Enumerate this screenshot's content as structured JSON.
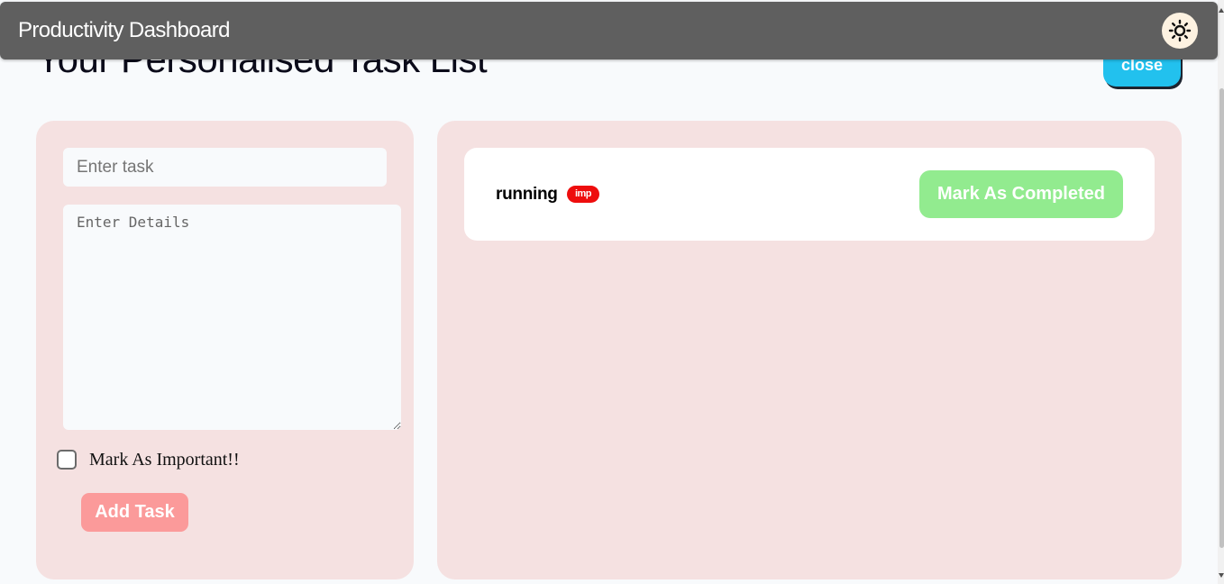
{
  "header": {
    "app_title": "Productivity Dashboard",
    "theme_toggle_icon": "sun-icon"
  },
  "main": {
    "page_title": "Your Personalised Task List",
    "close_label": "close",
    "accent_color": "#22c1ee"
  },
  "form": {
    "task_placeholder": "Enter task",
    "task_value": "",
    "details_placeholder": "Enter Details",
    "details_value": "",
    "important_label": "Mark As Important!!",
    "important_checked": false,
    "add_label": "Add Task",
    "add_color": "#fb9a9a"
  },
  "tasks": [
    {
      "name": "running",
      "badge": "imp",
      "badge_color": "#ee0d0d",
      "action_label": "Mark As Completed",
      "action_color": "#92eb8f"
    }
  ]
}
